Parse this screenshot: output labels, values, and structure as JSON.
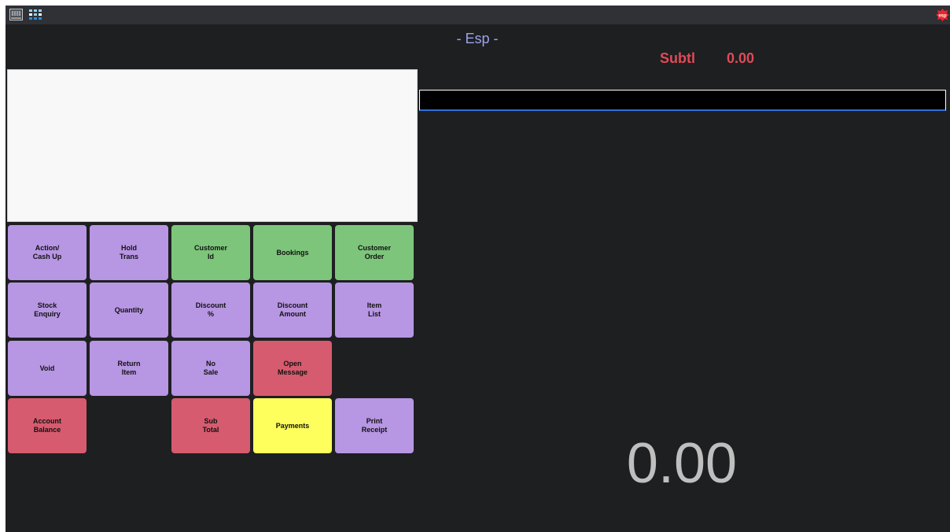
{
  "topbar": {
    "icons": [
      "terminal-icon",
      "grid-icon",
      "esp-logo-icon"
    ],
    "logo_text": "esp",
    "logo_color": "#e8262d"
  },
  "header": {
    "mode_title": "- Esp -",
    "subtotal_label": "Subtl",
    "subtotal_value": "0.00"
  },
  "entry": {
    "value": ""
  },
  "keypad": {
    "action_cash_up": "Action/\nCash Up",
    "hold_trans": "Hold\nTrans",
    "customer_id": "Customer\nId",
    "bookings": "Bookings",
    "customer_order": "Customer\nOrder",
    "stock_enquiry": "Stock\nEnquiry",
    "quantity": "Quantity",
    "discount_percent": "Discount\n%",
    "discount_amount": "Discount\nAmount",
    "item_list": "Item\nList",
    "void": "Void",
    "return_item": "Return\nItem",
    "no_sale": "No\nSale",
    "open_message": "Open\nMessage",
    "account_balance": "Account\nBalance",
    "sub_total": "Sub\nTotal",
    "payments": "Payments",
    "print_receipt": "Print\nReceipt"
  },
  "total_display": "0.00",
  "colors": {
    "background": "#1e1f21",
    "topbar": "#2f3137",
    "purple_key": "#b796e3",
    "green_key": "#7dc57a",
    "red_key": "#d65b6e",
    "yellow_key": "#fefe5c",
    "subtotal_text": "#e04a57",
    "title_text": "#9fa2ec",
    "total_text": "#bfbfbf"
  }
}
